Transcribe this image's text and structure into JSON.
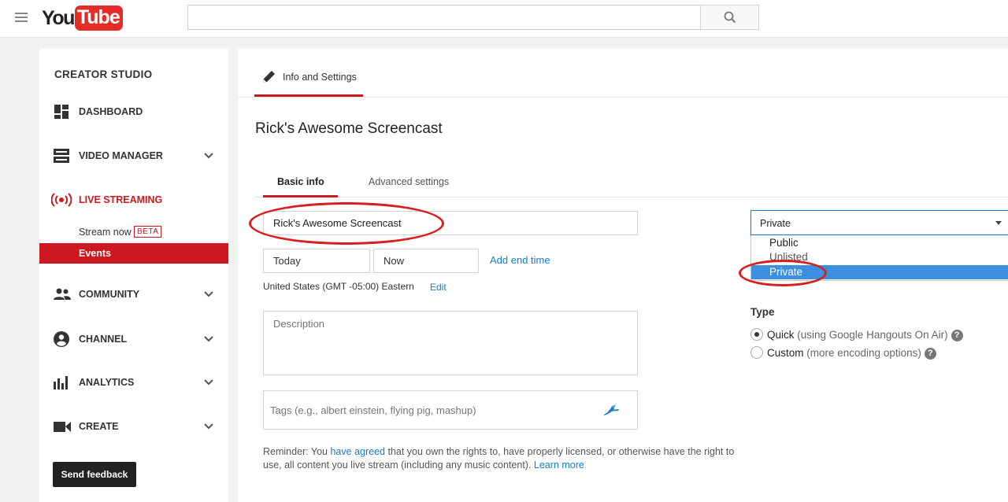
{
  "masthead": {
    "logo_you": "You",
    "logo_tube": "Tube",
    "search_placeholder": ""
  },
  "sidebar": {
    "title": "CREATOR STUDIO",
    "items": [
      {
        "label": "DASHBOARD",
        "icon": "dashboard-icon"
      },
      {
        "label": "VIDEO MANAGER",
        "icon": "video-manager-icon"
      },
      {
        "label": "LIVE STREAMING",
        "icon": "live-streaming-icon"
      },
      {
        "label": "COMMUNITY",
        "icon": "community-icon"
      },
      {
        "label": "CHANNEL",
        "icon": "channel-icon"
      },
      {
        "label": "ANALYTICS",
        "icon": "analytics-icon"
      },
      {
        "label": "CREATE",
        "icon": "create-icon"
      }
    ],
    "live_sub": {
      "stream_now": "Stream now",
      "beta": "BETA",
      "events": "Events"
    },
    "feedback_label": "Send feedback"
  },
  "main": {
    "top_tab": "Info and Settings",
    "video_title": "Rick's Awesome Screencast",
    "subtabs": {
      "basic": "Basic info",
      "advanced": "Advanced settings"
    },
    "form": {
      "title_value": "Rick's Awesome Screencast",
      "date_value": "Today",
      "time_value": "Now",
      "add_end_time": "Add end time",
      "timezone": "United States (GMT -05:00) Eastern",
      "timezone_edit": "Edit",
      "description_placeholder": "Description",
      "tags_placeholder": "Tags (e.g., albert einstein, flying pig, mashup)",
      "reminder_prefix": "Reminder: You ",
      "reminder_link1": "have agreed",
      "reminder_middle": " that you own the rights to, have properly licensed, or otherwise have the right to use, all content you live stream (including any music content). ",
      "reminder_link2": "Learn more"
    },
    "privacy": {
      "selected": "Private",
      "options": [
        "Public",
        "Unlisted",
        "Private"
      ]
    },
    "type": {
      "label": "Type",
      "quick_label": "Quick",
      "quick_hint": " (using Google Hangouts On Air)",
      "custom_label": "Custom",
      "custom_hint": " (more encoding options)",
      "help_glyph": "?"
    }
  },
  "colors": {
    "accent_red": "#cc181e",
    "link_blue": "#167ac6",
    "highlight_blue": "#3d8fe0",
    "annotation_red": "#d91e1e"
  }
}
